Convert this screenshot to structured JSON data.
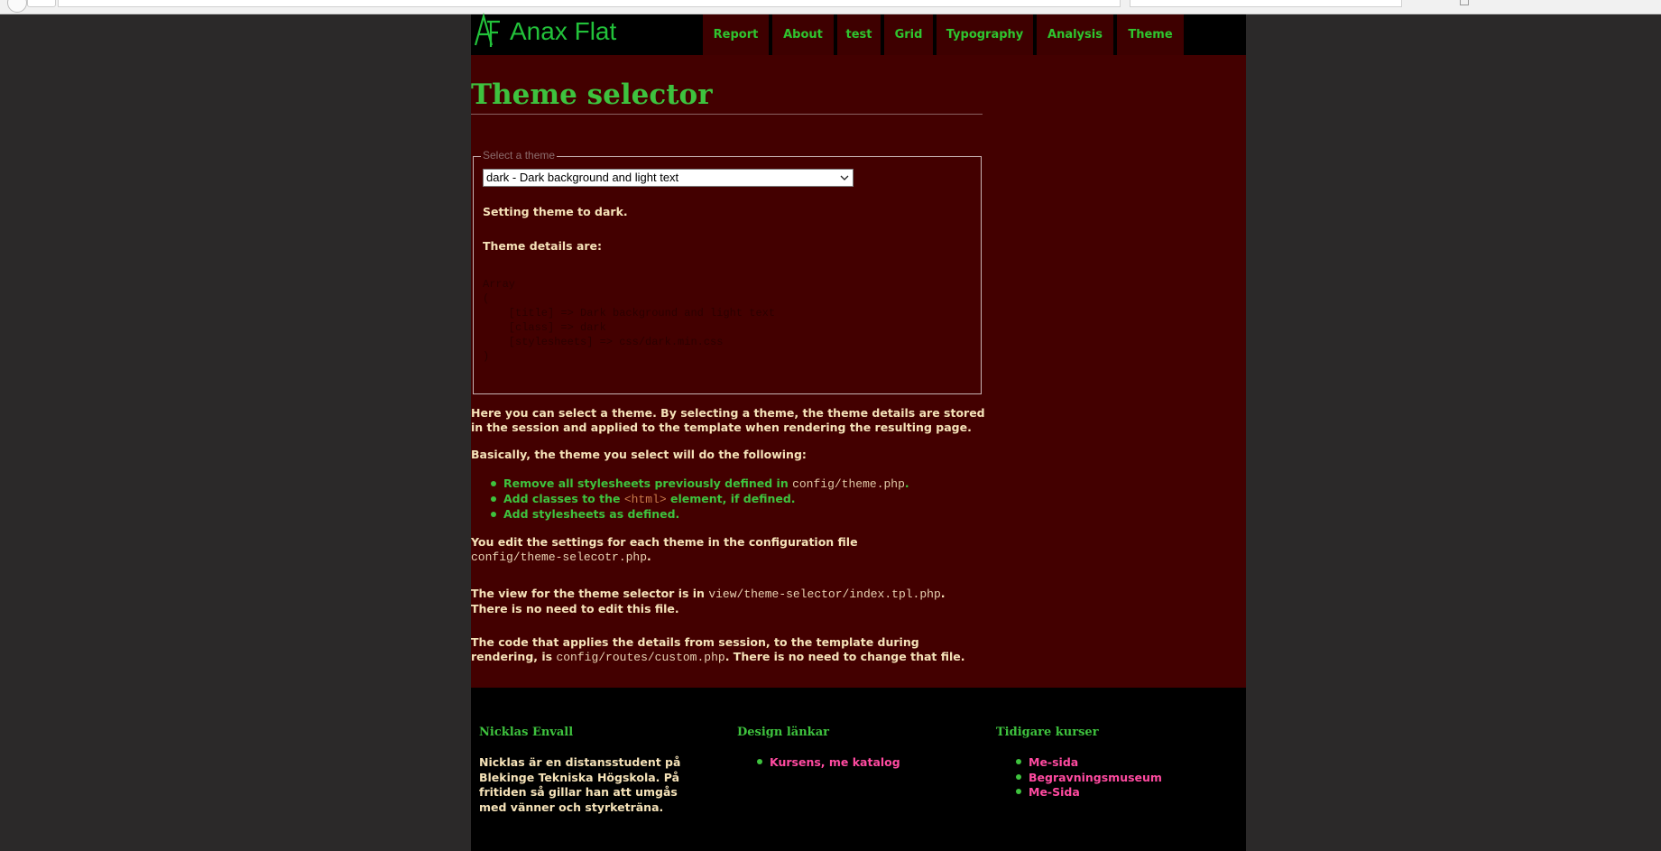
{
  "site": {
    "title": "Anax Flat"
  },
  "nav": {
    "items": [
      {
        "label": "Report"
      },
      {
        "label": "About"
      },
      {
        "label": "test"
      },
      {
        "label": "Grid"
      },
      {
        "label": "Typography"
      },
      {
        "label": "Analysis"
      },
      {
        "label": "Theme"
      }
    ]
  },
  "main": {
    "title": "Theme selector",
    "legend": "Select a theme",
    "select_value": "dark - Dark background and light text",
    "setting_msg": "Setting theme to dark.",
    "details_msg": "Theme details are:",
    "array_dump": [
      "Array",
      "(",
      "    [title] => Dark background and light text",
      "    [class] => dark",
      "    [stylesheets] => css/dark.min.css",
      ")"
    ],
    "intro": "Here you can select a theme. By selecting a theme, the theme details are stored in the session and applied to the template when rendering the resulting page.",
    "basically": "Basically, the theme you select will do the following:",
    "list": {
      "item1_text": "Remove all stylesheets previously defined in ",
      "item1_code": "config/theme.php",
      "item1_end": ".",
      "item2_text": "Add classes to the ",
      "item2_code": "<html>",
      "item2_end": " element, if defined.",
      "item3_text": "Add stylesheets as defined."
    },
    "edit_text": "You edit the settings for each theme in the configuration file ",
    "edit_code": "config/theme-selecotr.php",
    "edit_end": ".",
    "view_text": "The view for the theme selector is in ",
    "view_code": "view/theme-selector/index.tpl.php",
    "view_end": ". There is no need to edit this file.",
    "apply_text": "The code that applies the details from session, to the template during rendering, is ",
    "apply_code": "config/routes/custom.php",
    "apply_end": ". There is no need to change that file."
  },
  "footer": {
    "col1": {
      "title": "Nicklas Envall",
      "text": "Nicklas är en distansstudent på Blekinge Tekniska Högskola. På fritiden så gillar han att umgås med vänner och styrketräna."
    },
    "col2": {
      "title": "Design länkar",
      "links": [
        "Kursens, me katalog"
      ]
    },
    "col3": {
      "title": "Tidigare kurser",
      "links": [
        "Me-sida",
        "Begravningsmuseum",
        "Me-Sida"
      ]
    }
  },
  "colors": {
    "page_bg": "#430000",
    "outer_bg": "#2b2929",
    "accent_green": "#3ec23e",
    "text_cream": "#f5e2b8",
    "link_pink": "#ff4aa0"
  }
}
